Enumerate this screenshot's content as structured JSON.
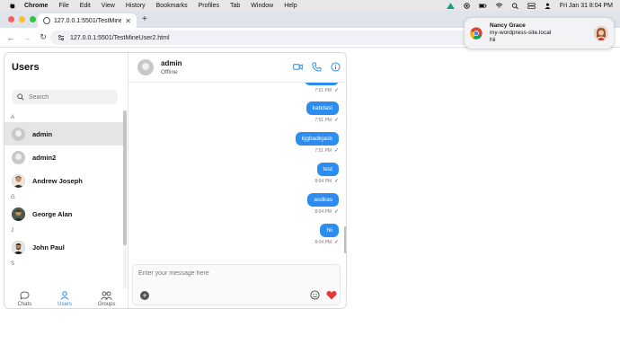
{
  "menubar": {
    "app": "Chrome",
    "items": [
      "File",
      "Edit",
      "View",
      "History",
      "Bookmarks",
      "Profiles",
      "Tab",
      "Window",
      "Help"
    ],
    "clock": "Fri Jan 31  8:04 PM"
  },
  "browser": {
    "tab_title": "127.0.0.1:5501/TestMineU",
    "url": "127.0.0.1:5501/TestMineUser2.html"
  },
  "notification": {
    "title": "Nancy Grace",
    "site": "my-wordpress-site.local",
    "message": "hii"
  },
  "sidebar": {
    "title": "Users",
    "search_placeholder": "Search",
    "groups": [
      {
        "letter": "A",
        "users": [
          {
            "name": "admin",
            "active": true,
            "photo": false
          },
          {
            "name": "admin2",
            "active": false,
            "photo": false
          },
          {
            "name": "Andrew Joseph",
            "active": false,
            "photo": true
          }
        ]
      },
      {
        "letter": "G",
        "users": [
          {
            "name": "George Alan",
            "active": false,
            "photo": true
          }
        ]
      },
      {
        "letter": "J",
        "users": [
          {
            "name": "John Paul",
            "active": false,
            "photo": true
          }
        ]
      },
      {
        "letter": "S",
        "users": []
      }
    ],
    "nav": [
      {
        "label": "Chats",
        "active": false
      },
      {
        "label": "Users",
        "active": true
      },
      {
        "label": "Groups",
        "active": false
      }
    ]
  },
  "chat": {
    "name": "admin",
    "status": "Offline",
    "messages": [
      {
        "text": "",
        "time": "7:51 PM"
      },
      {
        "text": "kabdasl",
        "time": "7:51 PM"
      },
      {
        "text": "kjgbadkjasb",
        "time": "7:51 PM"
      },
      {
        "text": "test",
        "time": "8:04 PM"
      },
      {
        "text": "asdkas",
        "time": "8:04 PM"
      },
      {
        "text": "hii",
        "time": "8:04 PM"
      }
    ],
    "composer_placeholder": "Enter your message here"
  },
  "colors": {
    "accent": "#2d8cf0",
    "heart": "#e53935"
  }
}
